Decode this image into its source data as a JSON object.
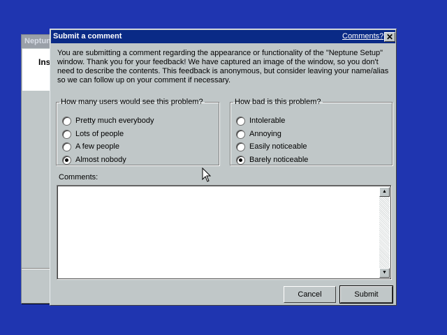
{
  "background_window": {
    "title": "Neptune",
    "text": "Ins"
  },
  "dialog": {
    "title": "Submit a comment",
    "comments_link": "Comments?",
    "close_glyph": "✕",
    "intro_lines": [
      "You are submitting a comment regarding the appearance or functionality of the \"Neptune Setup\"",
      "window. Thank you for your feedback! We have captured an image of the window, so you don't",
      "need to describe the contents. This feedback is anonymous, but consider leaving your name/alias",
      "so we can follow up on your comment if necessary."
    ],
    "group_users": {
      "legend": "How many users would see this problem?",
      "options": [
        "Pretty much everybody",
        "Lots of people",
        "A few people",
        "Almost nobody"
      ],
      "selected": "Almost nobody"
    },
    "group_severity": {
      "legend": "How bad is this problem?",
      "options": [
        "Intolerable",
        "Annoying",
        "Easily noticeable",
        "Barely noticeable"
      ],
      "selected": "Barely noticeable"
    },
    "comments_label": "Comments:",
    "comments_value": "",
    "scroll_up_glyph": "▲",
    "scroll_down_glyph": "▼",
    "cancel_label": "Cancel",
    "submit_label": "Submit"
  },
  "colors": {
    "desktop": "#1f35b0",
    "titlebar": "#0a2a86",
    "face": "#c0c7c8"
  }
}
